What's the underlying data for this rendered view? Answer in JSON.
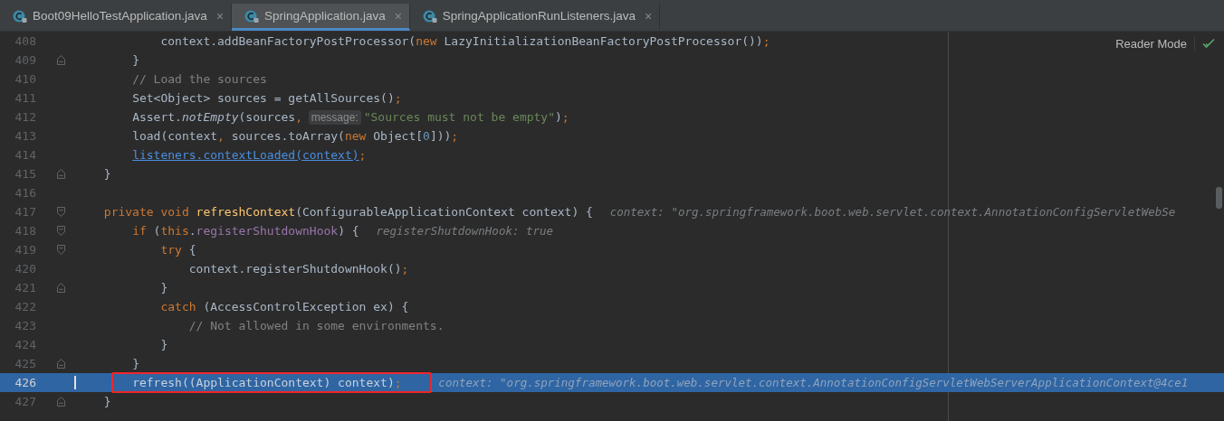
{
  "tabs": [
    {
      "label": "Boot09HelloTestApplication.java",
      "close": "×",
      "selected": false
    },
    {
      "label": "SpringApplication.java",
      "close": "×",
      "selected": true
    },
    {
      "label": "SpringApplicationRunListeners.java",
      "close": "×",
      "selected": false
    }
  ],
  "editor": {
    "reader_mode": "Reader Mode",
    "lines": [
      {
        "number": "408",
        "fold_start": false,
        "fold_end": false,
        "selected": false,
        "segments": [
          {
            "kind": "code",
            "boxed": false,
            "tokens": [
              {
                "kind": "plain",
                "text": "            context.addBeanFactoryPostProcessor("
              },
              {
                "kind": "keyword",
                "text": "new"
              },
              {
                "kind": "plain",
                "text": " LazyInitializationBeanFactoryPostProcessor())"
              },
              {
                "kind": "punct",
                "text": ";"
              }
            ]
          }
        ]
      },
      {
        "number": "409",
        "fold_start": false,
        "fold_end": true,
        "selected": false,
        "segments": [
          {
            "kind": "code",
            "boxed": false,
            "tokens": [
              {
                "kind": "plain",
                "text": "        }"
              }
            ]
          }
        ]
      },
      {
        "number": "410",
        "fold_start": false,
        "fold_end": false,
        "selected": false,
        "segments": [
          {
            "kind": "code",
            "boxed": false,
            "tokens": [
              {
                "kind": "comment",
                "text": "        // Load the sources"
              }
            ]
          }
        ]
      },
      {
        "number": "411",
        "fold_start": false,
        "fold_end": false,
        "selected": false,
        "segments": [
          {
            "kind": "code",
            "boxed": false,
            "tokens": [
              {
                "kind": "plain",
                "text": "        Set<Object> sources = getAllSources()"
              },
              {
                "kind": "punct",
                "text": ";"
              }
            ]
          }
        ]
      },
      {
        "number": "412",
        "fold_start": false,
        "fold_end": false,
        "selected": false,
        "segments": [
          {
            "kind": "code",
            "boxed": false,
            "tokens": [
              {
                "kind": "plain",
                "text": "        Assert."
              },
              {
                "kind": "static",
                "text": "notEmpty"
              },
              {
                "kind": "plain",
                "text": "(sources"
              },
              {
                "kind": "punct",
                "text": ","
              }
            ]
          },
          {
            "kind": "hint",
            "text": "message:"
          },
          {
            "kind": "code",
            "boxed": false,
            "tokens": [
              {
                "kind": "string",
                "text": "\"Sources must not be empty\""
              },
              {
                "kind": "plain",
                "text": ")"
              },
              {
                "kind": "punct",
                "text": ";"
              }
            ]
          }
        ]
      },
      {
        "number": "413",
        "fold_start": false,
        "fold_end": false,
        "selected": false,
        "segments": [
          {
            "kind": "code",
            "boxed": false,
            "tokens": [
              {
                "kind": "plain",
                "text": "        load(context"
              },
              {
                "kind": "punct",
                "text": ","
              },
              {
                "kind": "plain",
                "text": " sources.toArray("
              },
              {
                "kind": "keyword",
                "text": "new"
              },
              {
                "kind": "plain",
                "text": " Object["
              },
              {
                "kind": "number",
                "text": "0"
              },
              {
                "kind": "plain",
                "text": "]))"
              },
              {
                "kind": "punct",
                "text": ";"
              }
            ]
          }
        ]
      },
      {
        "number": "414",
        "fold_start": false,
        "fold_end": false,
        "selected": false,
        "segments": [
          {
            "kind": "code",
            "boxed": false,
            "tokens": [
              {
                "kind": "link",
                "text": "        listeners.contextLoaded(context)"
              },
              {
                "kind": "punct",
                "text": ";"
              }
            ]
          }
        ]
      },
      {
        "number": "415",
        "fold_start": false,
        "fold_end": true,
        "selected": false,
        "segments": [
          {
            "kind": "code",
            "boxed": false,
            "tokens": [
              {
                "kind": "plain",
                "text": "    }"
              }
            ]
          }
        ]
      },
      {
        "number": "416",
        "fold_start": false,
        "fold_end": false,
        "selected": false
      },
      {
        "number": "417",
        "fold_start": true,
        "fold_end": false,
        "selected": false,
        "segments": [
          {
            "kind": "code",
            "boxed": false,
            "tokens": [
              {
                "kind": "keyword",
                "text": "    private void "
              },
              {
                "kind": "method",
                "text": "refreshContext"
              },
              {
                "kind": "plain",
                "text": "(ConfigurableApplicationContext context) {"
              }
            ]
          },
          {
            "kind": "debug",
            "text": "context: \"org.springframework.boot.web.servlet.context.AnnotationConfigServletWebSe"
          }
        ]
      },
      {
        "number": "418",
        "fold_start": true,
        "fold_end": false,
        "selected": false,
        "segments": [
          {
            "kind": "code",
            "boxed": false,
            "tokens": [
              {
                "kind": "keyword",
                "text": "        if"
              },
              {
                "kind": "plain",
                "text": " ("
              },
              {
                "kind": "keyword",
                "text": "this"
              },
              {
                "kind": "plain",
                "text": "."
              },
              {
                "kind": "field",
                "text": "registerShutdownHook"
              },
              {
                "kind": "plain",
                "text": ") {"
              }
            ]
          },
          {
            "kind": "debug",
            "text": "registerShutdownHook: true"
          }
        ]
      },
      {
        "number": "419",
        "fold_start": true,
        "fold_end": false,
        "selected": false,
        "segments": [
          {
            "kind": "code",
            "boxed": false,
            "tokens": [
              {
                "kind": "keyword",
                "text": "            try"
              },
              {
                "kind": "plain",
                "text": " {"
              }
            ]
          }
        ]
      },
      {
        "number": "420",
        "fold_start": false,
        "fold_end": false,
        "selected": false,
        "segments": [
          {
            "kind": "code",
            "boxed": false,
            "tokens": [
              {
                "kind": "plain",
                "text": "                context.registerShutdownHook()"
              },
              {
                "kind": "punct",
                "text": ";"
              }
            ]
          }
        ]
      },
      {
        "number": "421",
        "fold_start": false,
        "fold_end": true,
        "selected": false,
        "segments": [
          {
            "kind": "code",
            "boxed": false,
            "tokens": [
              {
                "kind": "plain",
                "text": "            }"
              }
            ]
          }
        ]
      },
      {
        "number": "422",
        "fold_start": false,
        "fold_end": false,
        "selected": false,
        "segments": [
          {
            "kind": "code",
            "boxed": false,
            "tokens": [
              {
                "kind": "keyword",
                "text": "            catch"
              },
              {
                "kind": "plain",
                "text": " (AccessControlException ex) {"
              }
            ]
          }
        ]
      },
      {
        "number": "423",
        "fold_start": false,
        "fold_end": false,
        "selected": false,
        "segments": [
          {
            "kind": "code",
            "boxed": false,
            "tokens": [
              {
                "kind": "comment",
                "text": "                // Not allowed in some environments."
              }
            ]
          }
        ]
      },
      {
        "number": "424",
        "fold_start": false,
        "fold_end": false,
        "selected": false,
        "segments": [
          {
            "kind": "code",
            "boxed": false,
            "tokens": [
              {
                "kind": "plain",
                "text": "            }"
              }
            ]
          }
        ]
      },
      {
        "number": "425",
        "fold_start": false,
        "fold_end": true,
        "selected": false,
        "segments": [
          {
            "kind": "code",
            "boxed": false,
            "tokens": [
              {
                "kind": "plain",
                "text": "        }"
              }
            ]
          }
        ]
      },
      {
        "number": "426",
        "fold_start": false,
        "fold_end": false,
        "selected": true,
        "segments": [
          {
            "kind": "code",
            "boxed": true,
            "tokens": [
              {
                "kind": "plain",
                "text": "        refresh((ApplicationContext) context)"
              },
              {
                "kind": "punct",
                "text": ";"
              }
            ]
          },
          {
            "kind": "debug",
            "text": "context: \"org.springframework.boot.web.servlet.context.AnnotationConfigServletWebServerApplicationContext@4ce1"
          }
        ]
      },
      {
        "number": "427",
        "fold_start": false,
        "fold_end": true,
        "selected": false,
        "segments": [
          {
            "kind": "code",
            "boxed": false,
            "tokens": [
              {
                "kind": "plain",
                "text": "    }"
              }
            ]
          }
        ]
      }
    ]
  }
}
